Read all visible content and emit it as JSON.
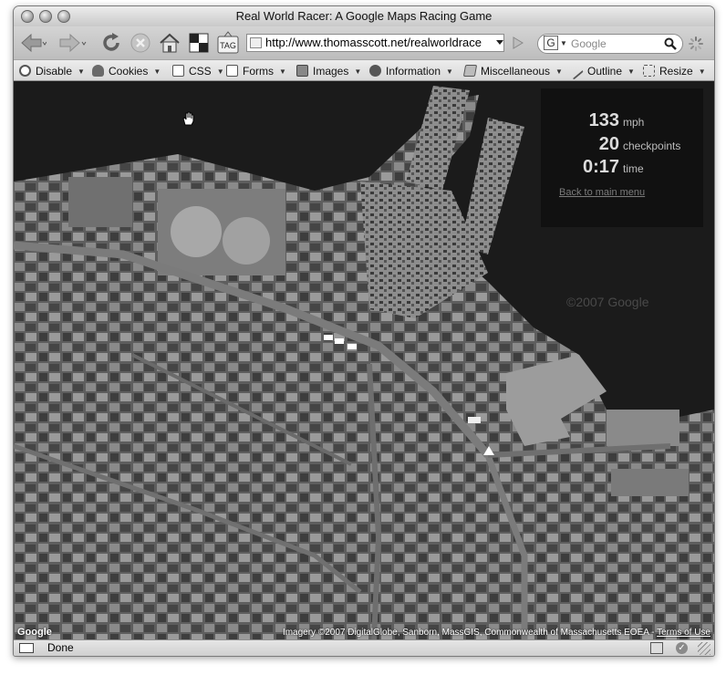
{
  "window": {
    "title": "Real World Racer: A Google Maps Racing Game"
  },
  "toolbar": {
    "url": "http://www.thomasscott.net/realworldrace",
    "search_placeholder": "Google",
    "tag_button_label": "TAG"
  },
  "webdev_toolbar": {
    "items": [
      {
        "label": "Disable",
        "icon": "disable-icon"
      },
      {
        "label": "Cookies",
        "icon": "cookies-icon"
      },
      {
        "label": "CSS",
        "icon": "css-icon"
      },
      {
        "label": "Forms",
        "icon": "forms-icon"
      },
      {
        "label": "Images",
        "icon": "images-icon"
      },
      {
        "label": "Information",
        "icon": "information-icon"
      },
      {
        "label": "Miscellaneous",
        "icon": "miscellaneous-icon"
      },
      {
        "label": "Outline",
        "icon": "outline-icon"
      },
      {
        "label": "Resize",
        "icon": "resize-icon"
      }
    ]
  },
  "hud": {
    "speed": "133",
    "speed_unit": "mph",
    "checkpoints": "20",
    "checkpoints_unit": "checkpoints",
    "time": "0:17",
    "time_unit": "time",
    "back_link": "Back to main menu"
  },
  "map": {
    "watermark": "©2007 Google",
    "attribution": "Imagery ©2007 DigitalGlobe, Sanborn, MassGIS, Commonwealth of Massachusetts EOEA - ",
    "terms_link": "Terms of Use",
    "logo": "Google"
  },
  "status": {
    "text": "Done"
  }
}
